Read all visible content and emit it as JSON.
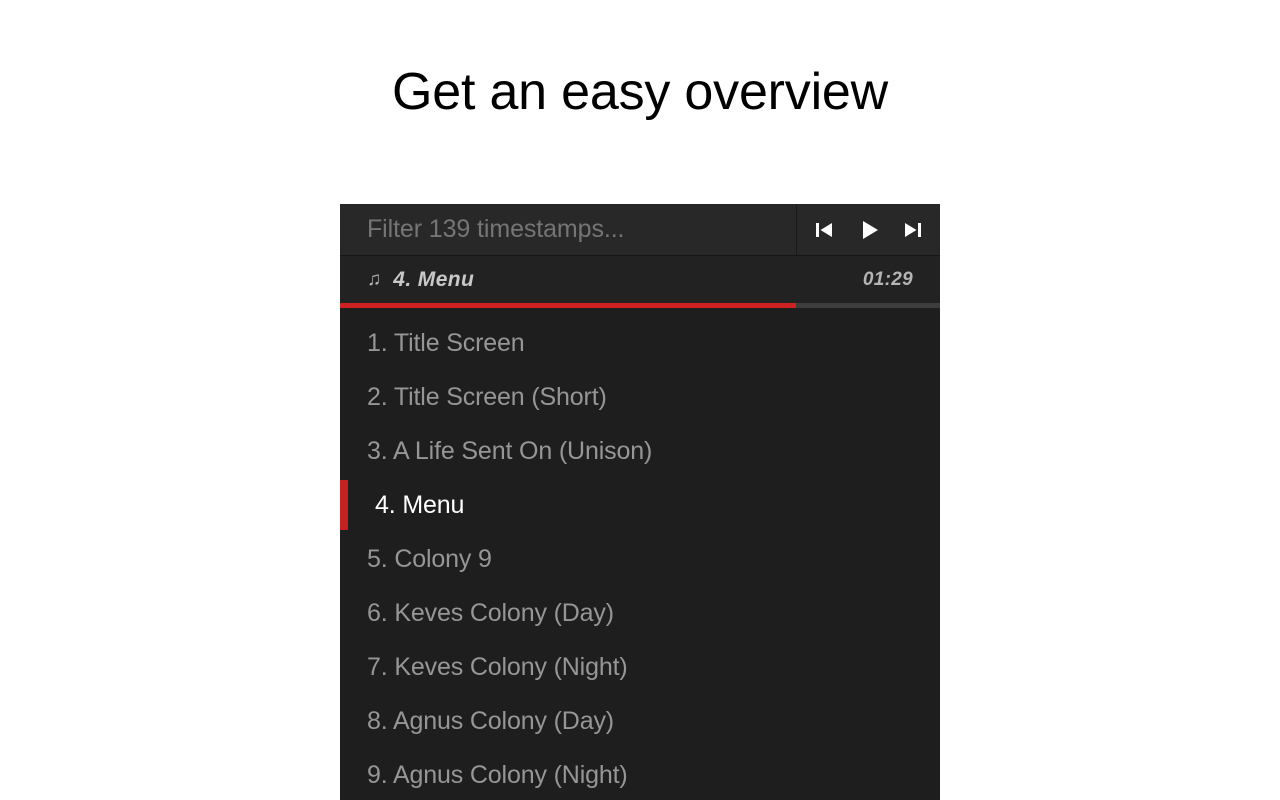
{
  "slide": {
    "title": "Get an easy overview"
  },
  "player": {
    "search": {
      "placeholder": "Filter 139 timestamps...",
      "value": "",
      "timestamp_count": "139"
    },
    "transport": {
      "previous_label": "Previous",
      "play_label": "Play",
      "next_label": "Next",
      "previous_icon": "skip-previous-icon",
      "play_icon": "play-icon",
      "next_icon": "skip-next-icon"
    },
    "now_playing": {
      "note_icon": "♫",
      "title": "4. Menu",
      "time": "01:29",
      "progress_percent": 76
    },
    "colors": {
      "accent_red": "#cc2222",
      "marker_red": "#c32222",
      "panel_bg": "#1e1e1e",
      "searchbar_bg": "#282828",
      "nowplaying_bg": "#222222",
      "track_text": "#969696",
      "active_track_text": "#ffffff"
    },
    "tracks": [
      {
        "label": "1. Title Screen",
        "active": false
      },
      {
        "label": "2. Title Screen (Short)",
        "active": false
      },
      {
        "label": "3. A Life Sent On (Unison)",
        "active": false
      },
      {
        "label": "4. Menu",
        "active": true
      },
      {
        "label": "5. Colony 9",
        "active": false
      },
      {
        "label": "6. Keves Colony (Day)",
        "active": false
      },
      {
        "label": "7. Keves Colony (Night)",
        "active": false
      },
      {
        "label": "8. Agnus Colony (Day)",
        "active": false
      },
      {
        "label": "9. Agnus Colony (Night)",
        "active": false
      }
    ]
  }
}
